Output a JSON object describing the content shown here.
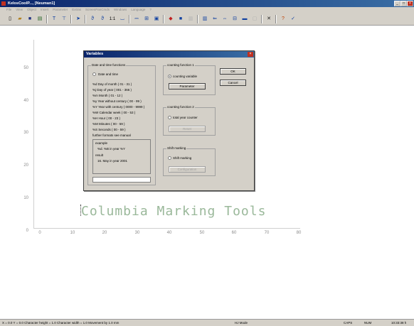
{
  "window": {
    "title": "KelosCoolP..., [Neuman1]"
  },
  "menu": [
    "File",
    "View",
    "Object",
    "Insert",
    "Parameter",
    "Extras",
    "ScreenPanCmds",
    "Windows",
    "Language",
    "?"
  ],
  "toolbar_icons": [
    "new-icon",
    "open-icon",
    "save-icon",
    "print-preview-icon",
    "text-tool-icon",
    "text-field-icon",
    "pointer-icon",
    "curve-icon",
    "curve-alt-icon",
    "ratio-icon",
    "frame-icon",
    "line-icon",
    "grid-icon",
    "insert-object-icon",
    "color-icon",
    "fill-icon",
    "hatch-icon",
    "barcode-icon",
    "arrow-left-icon",
    "arrow-right-icon",
    "table-icon",
    "bitmap-icon",
    "field-icon",
    "close-icon",
    "help-icon",
    "about-icon"
  ],
  "canvas": {
    "y_ticks": [
      "50",
      "40",
      "30",
      "20",
      "10",
      "0"
    ],
    "x_ticks": [
      "0",
      "10",
      "20",
      "30",
      "40",
      "50",
      "60",
      "70",
      "80"
    ],
    "marking_text": "Columbia Marking Tools"
  },
  "dialog": {
    "title": "Variables",
    "datetime_group": "Date and time functions",
    "datetime_radio": "Date and time",
    "items": [
      "%d    Day of month ( 01 - 31 )",
      "%j    Day of year ( 001 - 366 )",
      "%m    Month ( 01 - 12 )",
      "%y    Year without century ( 00 - 99 )",
      "%Y    Year with century ( 0000 - 9999 )",
      "%W    Calendar week ( 00 - 53 )",
      "%H    Hour ( 00 - 23 )",
      "%M    Minutes ( 00 - 59 )",
      "%S    Seconds ( 00 - 59 )",
      "further formats see manual"
    ],
    "example_label": "example",
    "example_line1": "%d. %B in year %Y",
    "result_label": "result",
    "result_line1": "16. May in year 2001",
    "counting1_group": "counting function 1",
    "counting_variable": "counting variable",
    "parameter_button": "Parameter",
    "counting2_group": "counting function 2",
    "total_counter": "total year counter",
    "reset_button": "Reset",
    "shift_group": "Shift marking",
    "shift_radio": "Shift marking",
    "configuration_button": "Configuration",
    "ok_button": "OK",
    "cancel_button": "Cancel"
  },
  "status": {
    "left": "X = 0.0  Y = 0.0  Character height = 1.0  Character width = 1.0  Movement by 1.0 mm",
    "mid": "HJ Mode",
    "num": "CAPS",
    "ins": "NUM",
    "time": "10:33:38 h"
  }
}
